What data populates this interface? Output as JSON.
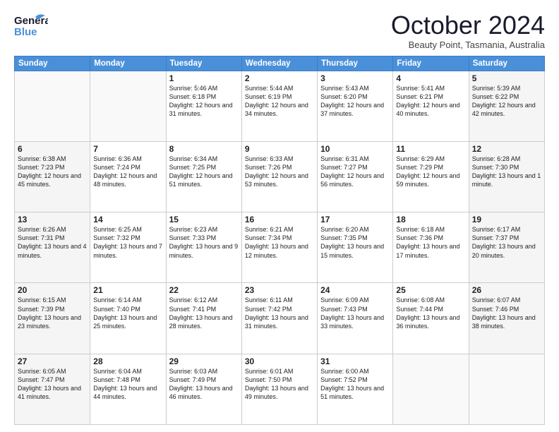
{
  "header": {
    "logo_line1": "General",
    "logo_line2": "Blue",
    "month": "October 2024",
    "location": "Beauty Point, Tasmania, Australia"
  },
  "days_of_week": [
    "Sunday",
    "Monday",
    "Tuesday",
    "Wednesday",
    "Thursday",
    "Friday",
    "Saturday"
  ],
  "weeks": [
    [
      {
        "day": "",
        "info": ""
      },
      {
        "day": "",
        "info": ""
      },
      {
        "day": "1",
        "info": "Sunrise: 5:46 AM\nSunset: 6:18 PM\nDaylight: 12 hours and 31 minutes."
      },
      {
        "day": "2",
        "info": "Sunrise: 5:44 AM\nSunset: 6:19 PM\nDaylight: 12 hours and 34 minutes."
      },
      {
        "day": "3",
        "info": "Sunrise: 5:43 AM\nSunset: 6:20 PM\nDaylight: 12 hours and 37 minutes."
      },
      {
        "day": "4",
        "info": "Sunrise: 5:41 AM\nSunset: 6:21 PM\nDaylight: 12 hours and 40 minutes."
      },
      {
        "day": "5",
        "info": "Sunrise: 5:39 AM\nSunset: 6:22 PM\nDaylight: 12 hours and 42 minutes."
      }
    ],
    [
      {
        "day": "6",
        "info": "Sunrise: 6:38 AM\nSunset: 7:23 PM\nDaylight: 12 hours and 45 minutes."
      },
      {
        "day": "7",
        "info": "Sunrise: 6:36 AM\nSunset: 7:24 PM\nDaylight: 12 hours and 48 minutes."
      },
      {
        "day": "8",
        "info": "Sunrise: 6:34 AM\nSunset: 7:25 PM\nDaylight: 12 hours and 51 minutes."
      },
      {
        "day": "9",
        "info": "Sunrise: 6:33 AM\nSunset: 7:26 PM\nDaylight: 12 hours and 53 minutes."
      },
      {
        "day": "10",
        "info": "Sunrise: 6:31 AM\nSunset: 7:27 PM\nDaylight: 12 hours and 56 minutes."
      },
      {
        "day": "11",
        "info": "Sunrise: 6:29 AM\nSunset: 7:29 PM\nDaylight: 12 hours and 59 minutes."
      },
      {
        "day": "12",
        "info": "Sunrise: 6:28 AM\nSunset: 7:30 PM\nDaylight: 13 hours and 1 minute."
      }
    ],
    [
      {
        "day": "13",
        "info": "Sunrise: 6:26 AM\nSunset: 7:31 PM\nDaylight: 13 hours and 4 minutes."
      },
      {
        "day": "14",
        "info": "Sunrise: 6:25 AM\nSunset: 7:32 PM\nDaylight: 13 hours and 7 minutes."
      },
      {
        "day": "15",
        "info": "Sunrise: 6:23 AM\nSunset: 7:33 PM\nDaylight: 13 hours and 9 minutes."
      },
      {
        "day": "16",
        "info": "Sunrise: 6:21 AM\nSunset: 7:34 PM\nDaylight: 13 hours and 12 minutes."
      },
      {
        "day": "17",
        "info": "Sunrise: 6:20 AM\nSunset: 7:35 PM\nDaylight: 13 hours and 15 minutes."
      },
      {
        "day": "18",
        "info": "Sunrise: 6:18 AM\nSunset: 7:36 PM\nDaylight: 13 hours and 17 minutes."
      },
      {
        "day": "19",
        "info": "Sunrise: 6:17 AM\nSunset: 7:37 PM\nDaylight: 13 hours and 20 minutes."
      }
    ],
    [
      {
        "day": "20",
        "info": "Sunrise: 6:15 AM\nSunset: 7:39 PM\nDaylight: 13 hours and 23 minutes."
      },
      {
        "day": "21",
        "info": "Sunrise: 6:14 AM\nSunset: 7:40 PM\nDaylight: 13 hours and 25 minutes."
      },
      {
        "day": "22",
        "info": "Sunrise: 6:12 AM\nSunset: 7:41 PM\nDaylight: 13 hours and 28 minutes."
      },
      {
        "day": "23",
        "info": "Sunrise: 6:11 AM\nSunset: 7:42 PM\nDaylight: 13 hours and 31 minutes."
      },
      {
        "day": "24",
        "info": "Sunrise: 6:09 AM\nSunset: 7:43 PM\nDaylight: 13 hours and 33 minutes."
      },
      {
        "day": "25",
        "info": "Sunrise: 6:08 AM\nSunset: 7:44 PM\nDaylight: 13 hours and 36 minutes."
      },
      {
        "day": "26",
        "info": "Sunrise: 6:07 AM\nSunset: 7:46 PM\nDaylight: 13 hours and 38 minutes."
      }
    ],
    [
      {
        "day": "27",
        "info": "Sunrise: 6:05 AM\nSunset: 7:47 PM\nDaylight: 13 hours and 41 minutes."
      },
      {
        "day": "28",
        "info": "Sunrise: 6:04 AM\nSunset: 7:48 PM\nDaylight: 13 hours and 44 minutes."
      },
      {
        "day": "29",
        "info": "Sunrise: 6:03 AM\nSunset: 7:49 PM\nDaylight: 13 hours and 46 minutes."
      },
      {
        "day": "30",
        "info": "Sunrise: 6:01 AM\nSunset: 7:50 PM\nDaylight: 13 hours and 49 minutes."
      },
      {
        "day": "31",
        "info": "Sunrise: 6:00 AM\nSunset: 7:52 PM\nDaylight: 13 hours and 51 minutes."
      },
      {
        "day": "",
        "info": ""
      },
      {
        "day": "",
        "info": ""
      }
    ]
  ]
}
